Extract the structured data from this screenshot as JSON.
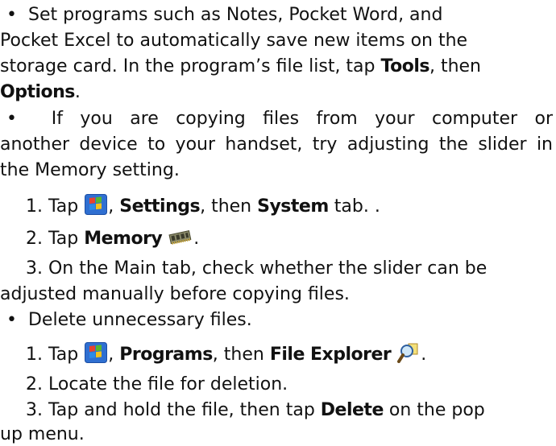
{
  "bullet": "•",
  "b1": {
    "l1": "Set programs such as Notes, Pocket Word, and",
    "l2": "Pocket Excel to automatically save new items on the",
    "l3a": "storage card. In the program’s file list, tap ",
    "l3b": "Tools",
    "l3c": ", then",
    "l4a": "Options",
    "l4b": "."
  },
  "b2": {
    "l1": "If you are copying files from your computer or",
    "l2": "another device to your handset, try adjusting the slider in",
    "l3": "the Memory setting."
  },
  "s1": {
    "a": "1. Tap ",
    "b": ", ",
    "c": "Settings",
    "d": ", then ",
    "e": "System",
    "f": " tab. ."
  },
  "s2": {
    "a": "2. Tap ",
    "b": "Memory",
    "c": "."
  },
  "s3": {
    "a": "3. On the Main tab, check whether the slider can be",
    "b": "adjusted manually before copying files."
  },
  "b3": {
    "l1": "Delete unnecessary files."
  },
  "t1": {
    "a": "1. Tap ",
    "b": ", ",
    "c": "Programs",
    "d": ", then ",
    "e": "File Explorer",
    "f": "."
  },
  "t2": {
    "a": "2. Locate the file for deletion."
  },
  "t3": {
    "a": "3. Tap and hold the file, then tap ",
    "b": "Delete",
    "c": " on the pop",
    "d": "up menu."
  }
}
